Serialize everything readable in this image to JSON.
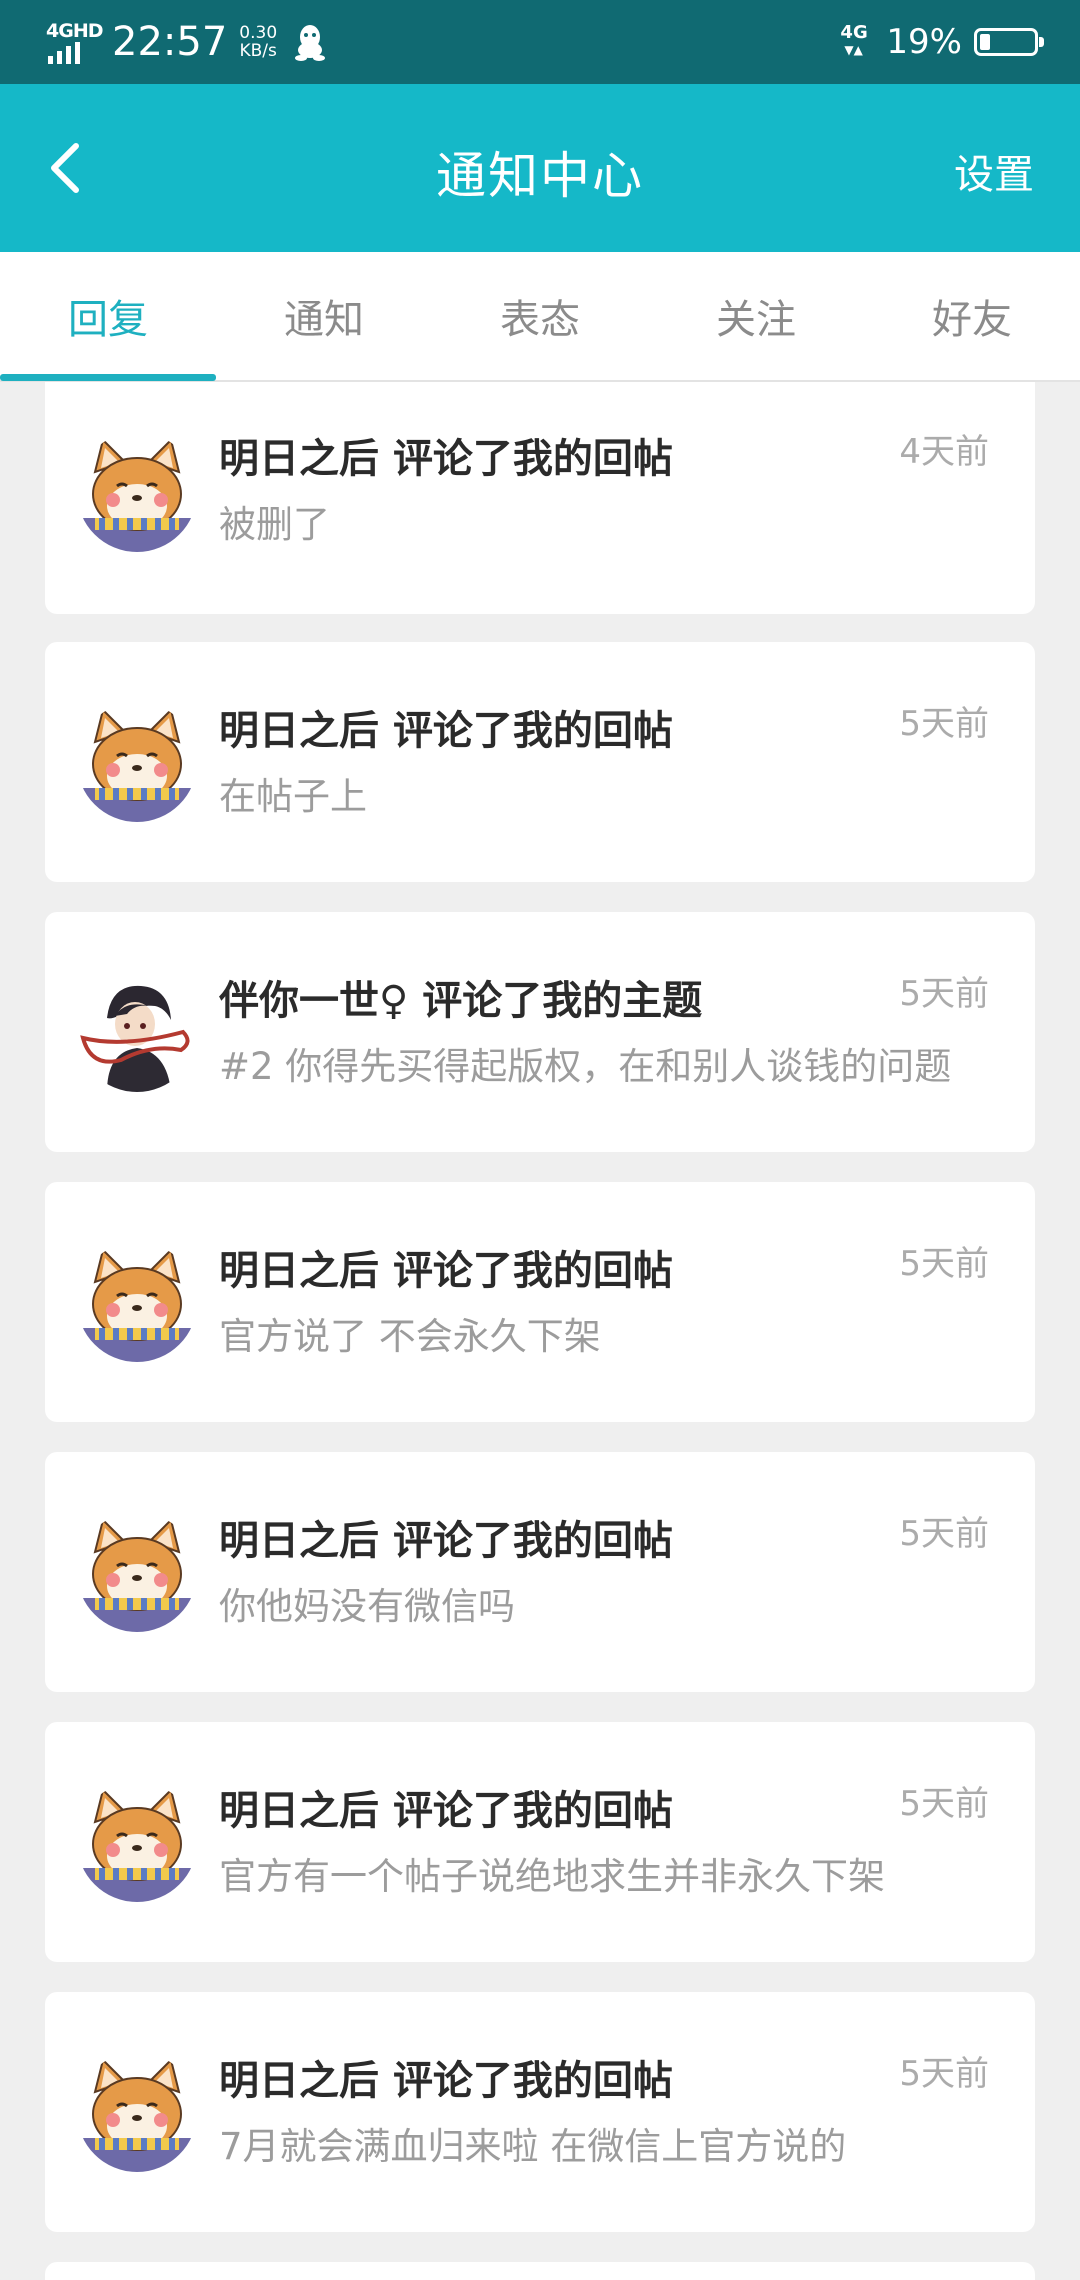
{
  "status_bar": {
    "network_label": "4GHD",
    "time": "22:57",
    "speed_value": "0.30",
    "speed_unit": "KB/s",
    "right_network": "4G",
    "battery_text": "19%",
    "battery_level_percent": 19
  },
  "header": {
    "title": "通知中心",
    "settings_label": "设置"
  },
  "tabs": [
    {
      "label": "回复",
      "active": true
    },
    {
      "label": "通知",
      "active": false
    },
    {
      "label": "表态",
      "active": false
    },
    {
      "label": "关注",
      "active": false
    },
    {
      "label": "好友",
      "active": false
    }
  ],
  "notifications": [
    {
      "name": "明日之后",
      "action": "评论了我的回帖",
      "time": "4天前",
      "content": "被删了",
      "avatar": "shiba-avatar"
    },
    {
      "name": "明日之后",
      "action": "评论了我的回帖",
      "time": "5天前",
      "content": "在帖子上",
      "avatar": "shiba-avatar"
    },
    {
      "name": "伴你一世♀",
      "action": "评论了我的主题",
      "time": "5天前",
      "content": "#2 你得先买得起版权，在和别人谈钱的问题",
      "avatar": "anime-boy-avatar"
    },
    {
      "name": "明日之后",
      "action": "评论了我的回帖",
      "time": "5天前",
      "content": "官方说了  不会永久下架",
      "avatar": "shiba-avatar"
    },
    {
      "name": "明日之后",
      "action": "评论了我的回帖",
      "time": "5天前",
      "content": "你他妈没有微信吗",
      "avatar": "shiba-avatar"
    },
    {
      "name": "明日之后",
      "action": "评论了我的回帖",
      "time": "5天前",
      "content": "官方有一个帖子说绝地求生并非永久下架",
      "avatar": "shiba-avatar"
    },
    {
      "name": "明日之后",
      "action": "评论了我的回帖",
      "time": "5天前",
      "content": "7月就会满血归来啦  在微信上官方说的",
      "avatar": "shiba-avatar"
    }
  ],
  "colors": {
    "status_bar": "#106a72",
    "header": "#15b8c8",
    "accent": "#1eb0c0",
    "background": "#efefef"
  }
}
